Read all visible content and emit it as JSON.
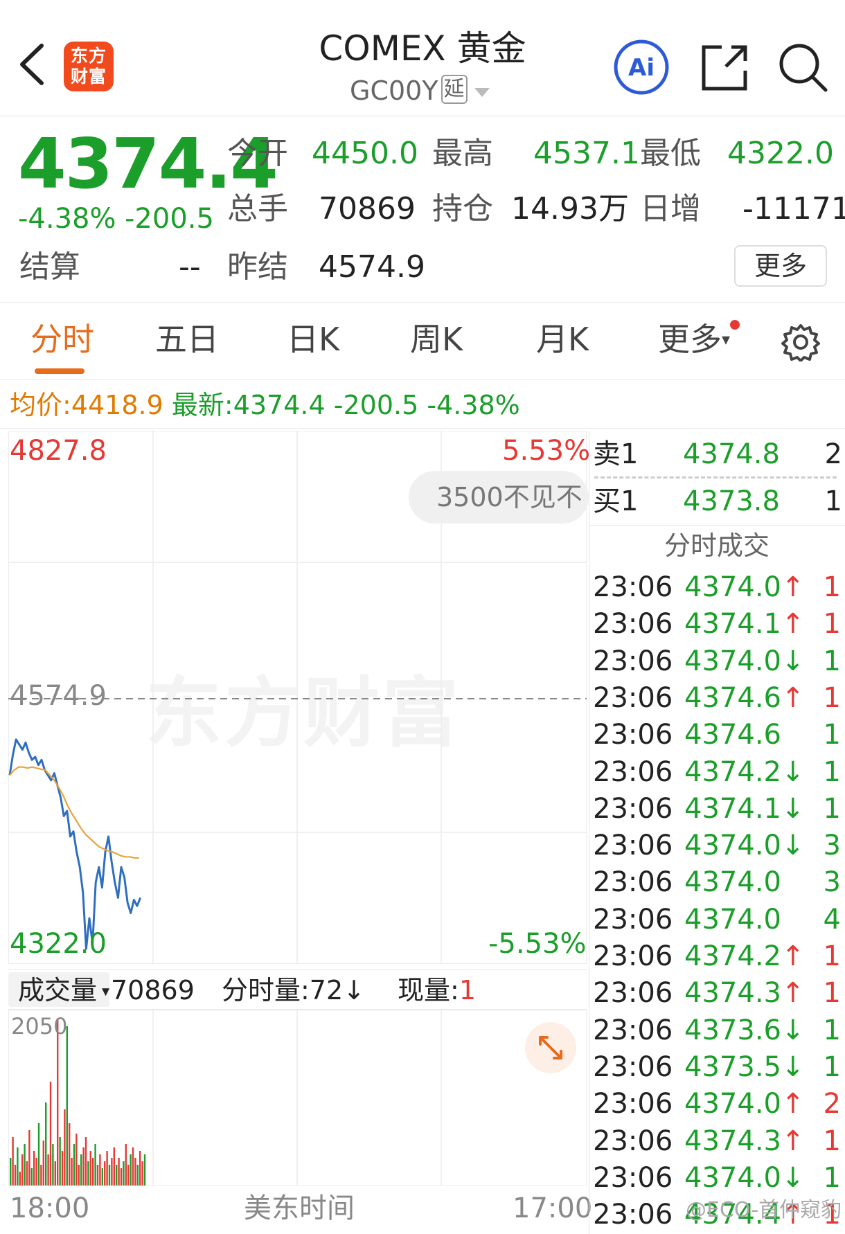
{
  "header": {
    "logo_line1": "东方",
    "logo_line2": "财富",
    "title": "COMEX 黄金",
    "code": "GC00Y",
    "delay_badge": "延",
    "ai_label": "Ai"
  },
  "quote": {
    "price": "4374.4",
    "change_pct": "-4.38%",
    "change": "-200.5",
    "open_label": "今开",
    "open": "4450.0",
    "high_label": "最高",
    "high": "4537.1",
    "low_label": "最低",
    "low": "4322.0",
    "volume_label": "总手",
    "volume": "70869",
    "oi_label": "持仓",
    "oi": "14.93万",
    "daily_inc_label": "日增",
    "daily_inc": "-11171",
    "settle_label": "结算",
    "settle": "--",
    "prev_settle_label": "昨结",
    "prev_settle": "4574.9",
    "more": "更多"
  },
  "tabs": [
    {
      "label": "分时",
      "active": true
    },
    {
      "label": "五日"
    },
    {
      "label": "日K"
    },
    {
      "label": "周K"
    },
    {
      "label": "月K"
    },
    {
      "label": "更多"
    }
  ],
  "info_line": {
    "avg_label": "均价:",
    "avg": "4418.9",
    "latest_label": "最新:",
    "latest": "4374.4",
    "change": "-200.5",
    "change_pct": "-4.38%"
  },
  "chart": {
    "high_label": "4827.8",
    "low_label": "4322.0",
    "prev_label": "4574.9",
    "pct_high": "5.53%",
    "pct_low": "-5.53%",
    "toast": "3500不见不",
    "watermark": "东方财富",
    "vol_selector": "成交量",
    "vol_total": "70869",
    "vol_minute": "分时量:72↓",
    "vol_now_label": "现量:",
    "vol_now": "1",
    "vol_max": "2050",
    "time_start": "18:00",
    "time_mid": "美东时间",
    "time_end": "17:00",
    "colors": {
      "price_line": "#2f6fbf",
      "avg_line": "#e8a33d",
      "up": "#e53935",
      "down": "#1b9e2a"
    }
  },
  "chart_data": {
    "type": "line",
    "ylim": [
      4322.0,
      4827.8
    ],
    "reference": 4574.9,
    "series": [
      {
        "values": [
          4500,
          4520,
          4535,
          4530,
          4525,
          4532,
          4522,
          4515,
          4518,
          4510,
          4515,
          4505,
          4500,
          4495,
          4502,
          4490,
          4478,
          4460,
          4465,
          4440,
          4445,
          4425,
          4410,
          4385,
          4330,
          4360,
          4335,
          4395,
          4410,
          4390,
          4425,
          4440,
          4415,
          4395,
          4380,
          4410,
          4400,
          4375,
          4365,
          4378,
          4372,
          4380
        ]
      },
      {
        "values": [
          4500,
          4505,
          4508,
          4508,
          4507,
          4508,
          4507,
          4506,
          4505,
          4500,
          4495,
          4488,
          4480,
          4470,
          4462,
          4455,
          4448,
          4442,
          4438,
          4434,
          4430,
          4428,
          4426,
          4425,
          4423,
          4421,
          4420,
          4420,
          4419,
          4419
        ]
      }
    ]
  },
  "orderbook": {
    "sell_label": "卖1",
    "sell_price": "4374.8",
    "sell_vol": "2",
    "buy_label": "买1",
    "buy_price": "4373.8",
    "buy_vol": "1"
  },
  "trades_title": "分时成交",
  "trades": [
    {
      "time": "23:06",
      "price": "4374.0",
      "dir": "↑",
      "vol": "1",
      "vc": "red"
    },
    {
      "time": "23:06",
      "price": "4374.1",
      "dir": "↑",
      "vol": "1",
      "vc": "red"
    },
    {
      "time": "23:06",
      "price": "4374.0",
      "dir": "↓",
      "vol": "1",
      "vc": "green"
    },
    {
      "time": "23:06",
      "price": "4374.6",
      "dir": "↑",
      "vol": "1",
      "vc": "red"
    },
    {
      "time": "23:06",
      "price": "4374.6",
      "dir": "",
      "vol": "1",
      "vc": "green"
    },
    {
      "time": "23:06",
      "price": "4374.2",
      "dir": "↓",
      "vol": "1",
      "vc": "green"
    },
    {
      "time": "23:06",
      "price": "4374.1",
      "dir": "↓",
      "vol": "1",
      "vc": "green"
    },
    {
      "time": "23:06",
      "price": "4374.0",
      "dir": "↓",
      "vol": "3",
      "vc": "green"
    },
    {
      "time": "23:06",
      "price": "4374.0",
      "dir": "",
      "vol": "3",
      "vc": "green"
    },
    {
      "time": "23:06",
      "price": "4374.0",
      "dir": "",
      "vol": "4",
      "vc": "green"
    },
    {
      "time": "23:06",
      "price": "4374.2",
      "dir": "↑",
      "vol": "1",
      "vc": "red"
    },
    {
      "time": "23:06",
      "price": "4374.3",
      "dir": "↑",
      "vol": "1",
      "vc": "red"
    },
    {
      "time": "23:06",
      "price": "4373.6",
      "dir": "↓",
      "vol": "1",
      "vc": "green"
    },
    {
      "time": "23:06",
      "price": "4373.5",
      "dir": "↓",
      "vol": "1",
      "vc": "green"
    },
    {
      "time": "23:06",
      "price": "4374.0",
      "dir": "↑",
      "vol": "2",
      "vc": "red"
    },
    {
      "time": "23:06",
      "price": "4374.3",
      "dir": "↑",
      "vol": "1",
      "vc": "red"
    },
    {
      "time": "23:06",
      "price": "4374.0",
      "dir": "↓",
      "vol": "1",
      "vc": "green"
    },
    {
      "time": "23:06",
      "price": "4374.4",
      "dir": "↑",
      "vol": "1",
      "vc": "red"
    }
  ],
  "watermark_source": "@ECO-首仲窥豹"
}
